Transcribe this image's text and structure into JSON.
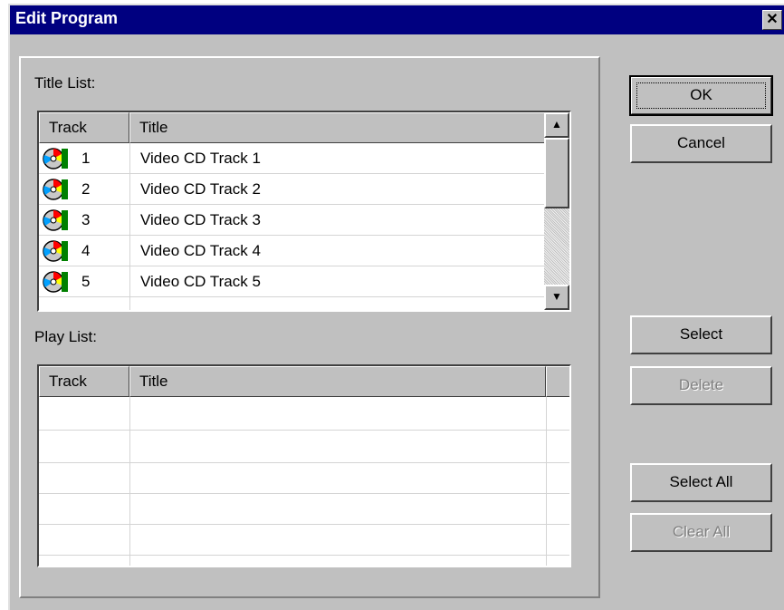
{
  "window": {
    "title": "Edit Program",
    "close_glyph": "✕"
  },
  "title_list": {
    "label": "Title List:",
    "columns": [
      "Track",
      "Title"
    ],
    "rows": [
      {
        "track": "1",
        "title": "Video CD Track 1",
        "icon": "video-cd-icon"
      },
      {
        "track": "2",
        "title": "Video CD Track 2",
        "icon": "video-cd-icon"
      },
      {
        "track": "3",
        "title": "Video CD Track 3",
        "icon": "video-cd-icon"
      },
      {
        "track": "4",
        "title": "Video CD Track 4",
        "icon": "video-cd-icon"
      },
      {
        "track": "5",
        "title": "Video CD Track 5",
        "icon": "video-cd-icon"
      }
    ]
  },
  "play_list": {
    "label": "Play List:",
    "columns": [
      "Track",
      "Title"
    ],
    "rows": []
  },
  "buttons": {
    "ok": "OK",
    "cancel": "Cancel",
    "select": "Select",
    "delete": "Delete",
    "select_all": "Select All",
    "clear_all": "Clear All"
  },
  "colors": {
    "titlebar": "#000080",
    "face": "#c0c0c0",
    "disabled_text": "#808080"
  }
}
